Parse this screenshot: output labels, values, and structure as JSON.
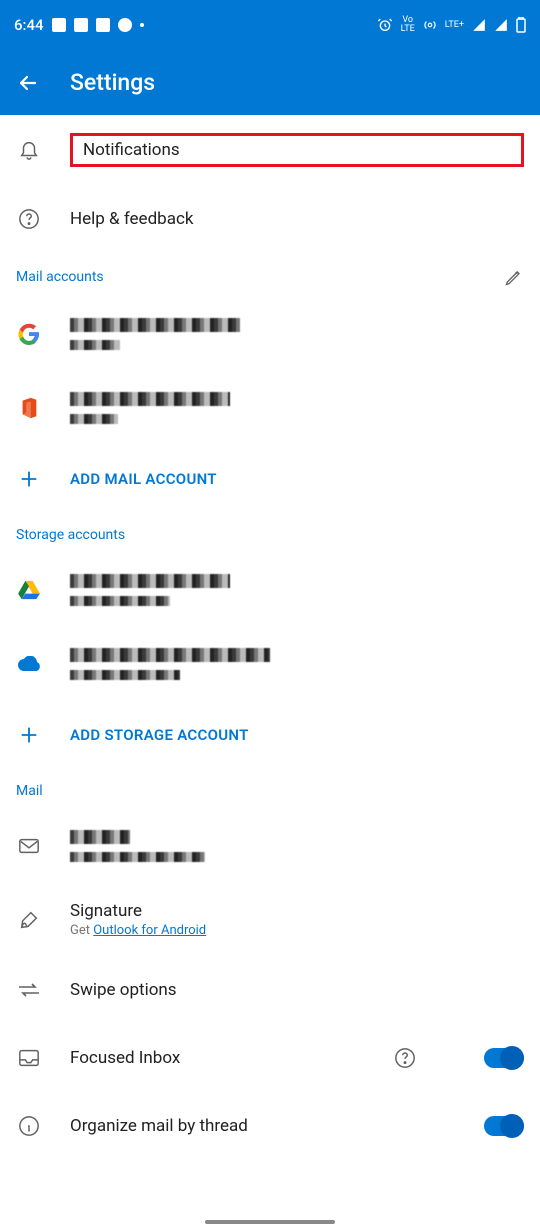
{
  "statusbar": {
    "time": "6:44",
    "lte_label": "LTE+",
    "vo_label": "Vo\nLTE"
  },
  "header": {
    "title": "Settings"
  },
  "items": {
    "notifications": "Notifications",
    "help": "Help & feedback"
  },
  "sections": {
    "mail_accounts": "Mail accounts",
    "storage_accounts": "Storage accounts",
    "mail": "Mail"
  },
  "actions": {
    "add_mail": "ADD MAIL ACCOUNT",
    "add_storage": "ADD STORAGE ACCOUNT"
  },
  "mail": {
    "signature_title": "Signature",
    "signature_prefix": "Get ",
    "signature_link": "Outlook for Android",
    "swipe": "Swipe options",
    "focused": "Focused Inbox",
    "organize": "Organize mail by thread"
  },
  "colors": {
    "brand": "#0078D4",
    "highlight": "#E81123"
  }
}
